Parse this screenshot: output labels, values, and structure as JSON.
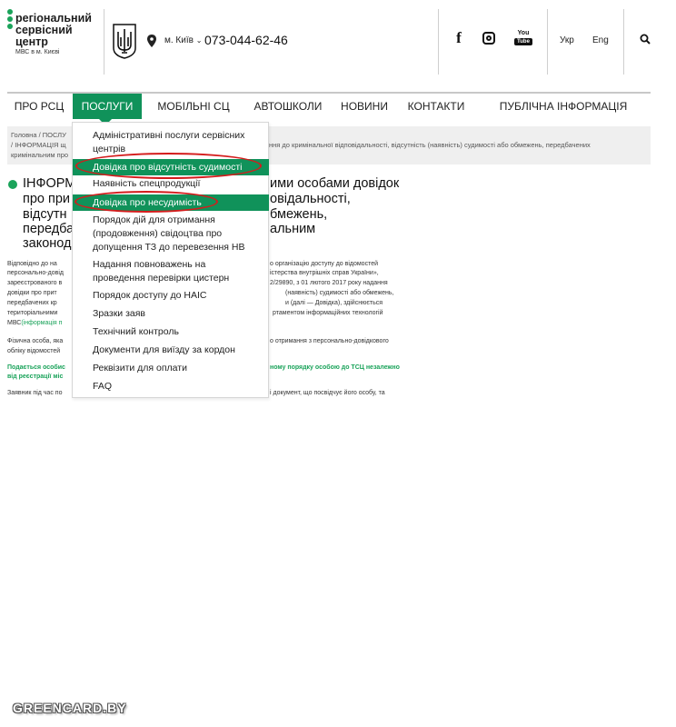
{
  "header": {
    "logo_line1": "регіональний",
    "logo_line2": "сервісний",
    "logo_line3": "центр",
    "logo_sub": "МВС в м. Києві",
    "city": "м. Київ",
    "phone": "073-044-62-46",
    "lang_uk": "Укр",
    "lang_en": "Eng",
    "youtube_text": "You",
    "youtube_tube": "Tube",
    "facebook_glyph": "f",
    "icons": [
      "trident-emblem-icon",
      "location-pin-icon",
      "chevron-down-icon",
      "facebook-icon",
      "instagram-icon",
      "youtube-icon",
      "search-icon"
    ]
  },
  "nav": {
    "items": [
      {
        "label": "ПРО РСЦ"
      },
      {
        "label": "ПОСЛУГИ"
      },
      {
        "label": "МОБІЛЬНІ СЦ"
      },
      {
        "label": "АВТОШКОЛИ"
      },
      {
        "label": "НОВИНИ"
      },
      {
        "label": "КОНТАКТИ"
      },
      {
        "label": "ПУБЛІЧНА ІНФОРМАЦІЯ"
      }
    ],
    "active_color": "#10925a"
  },
  "breadcrumb": {
    "home": "Головна",
    "sep": "/",
    "section": "ПОСЛУ",
    "current_start": "ІНФОРМАЦІЯ щ",
    "current_mid": "ння до кримінальної відповідальності, відсутність (наявність) судимості або обмежень, передбачених",
    "current_end": "кримінальним про"
  },
  "article": {
    "title_lines": [
      {
        "left": "ІНФОРМ",
        "right": "ими особами довідок"
      },
      {
        "left": "про при",
        "right": "овідальності,"
      },
      {
        "left": "відсутн",
        "right": "бмежень,"
      },
      {
        "left": "передба",
        "right": "альним"
      },
      {
        "left": "законод",
        "right": ""
      }
    ],
    "paragraph1": [
      {
        "left": "Відповідно до на",
        "right": "о організацію доступу до відомостей"
      },
      {
        "left": "персонально-довід",
        "right": "істерства внутрішніх справ України»,"
      },
      {
        "left": "зареєстрованого в",
        "right": "2/29890, з 01 лютого 2017 року надання"
      },
      {
        "left": "довідки про прит",
        "right": "(наявність) судимості або обмежень,"
      },
      {
        "left": "передбачених кр",
        "right": "и (далі — Довідка), здійснюється"
      },
      {
        "left": "територіальними",
        "right": "ртаментом інформаційних технологій"
      },
      {
        "left": "МВС",
        "link": "(інформація п",
        "right": ""
      }
    ],
    "paragraph2": [
      {
        "left": "Фізична особа, яка",
        "right": "о отримання з персонально-довідкового"
      },
      {
        "left": "обліку відомостей",
        "right": ""
      }
    ],
    "paragraph3": [
      {
        "left": "Подається особис",
        "right": "ному порядку особою до ТСЦ незалежно"
      },
      {
        "left": "від реєстрації міс",
        "right": ""
      }
    ],
    "paragraph4": [
      {
        "left": "Заявник під час по",
        "right": "і документ, що посвідчує його особу, та"
      }
    ],
    "accent_color": "#1aa35a"
  },
  "dropdown": {
    "items": [
      {
        "label": "Адміністративні послуги сервісних",
        "label2": "центрів"
      },
      {
        "label": "Довідка про відсутність судимості",
        "highlighted": true
      },
      {
        "label": "Наявність спецпродукції"
      },
      {
        "label": "Довідка про несудимість",
        "highlighted": true
      },
      {
        "label": "Порядок дій для отримання",
        "label2": "(продовження) свідоцтва про",
        "label3": "допущення ТЗ до перевезення НВ"
      },
      {
        "label": "Надання повноважень на",
        "label2": "проведення перевірки цистерн"
      },
      {
        "label": "Порядок доступу до НАІС"
      },
      {
        "label": "Зразки заяв"
      },
      {
        "label": "Технічний контроль"
      },
      {
        "label": "Документи для виїзду за кордон"
      },
      {
        "label": "Реквізити для оплати"
      },
      {
        "label": "FAQ"
      }
    ],
    "annotation_color": "#d41c1c"
  },
  "watermark": "GREENCARD.BY"
}
